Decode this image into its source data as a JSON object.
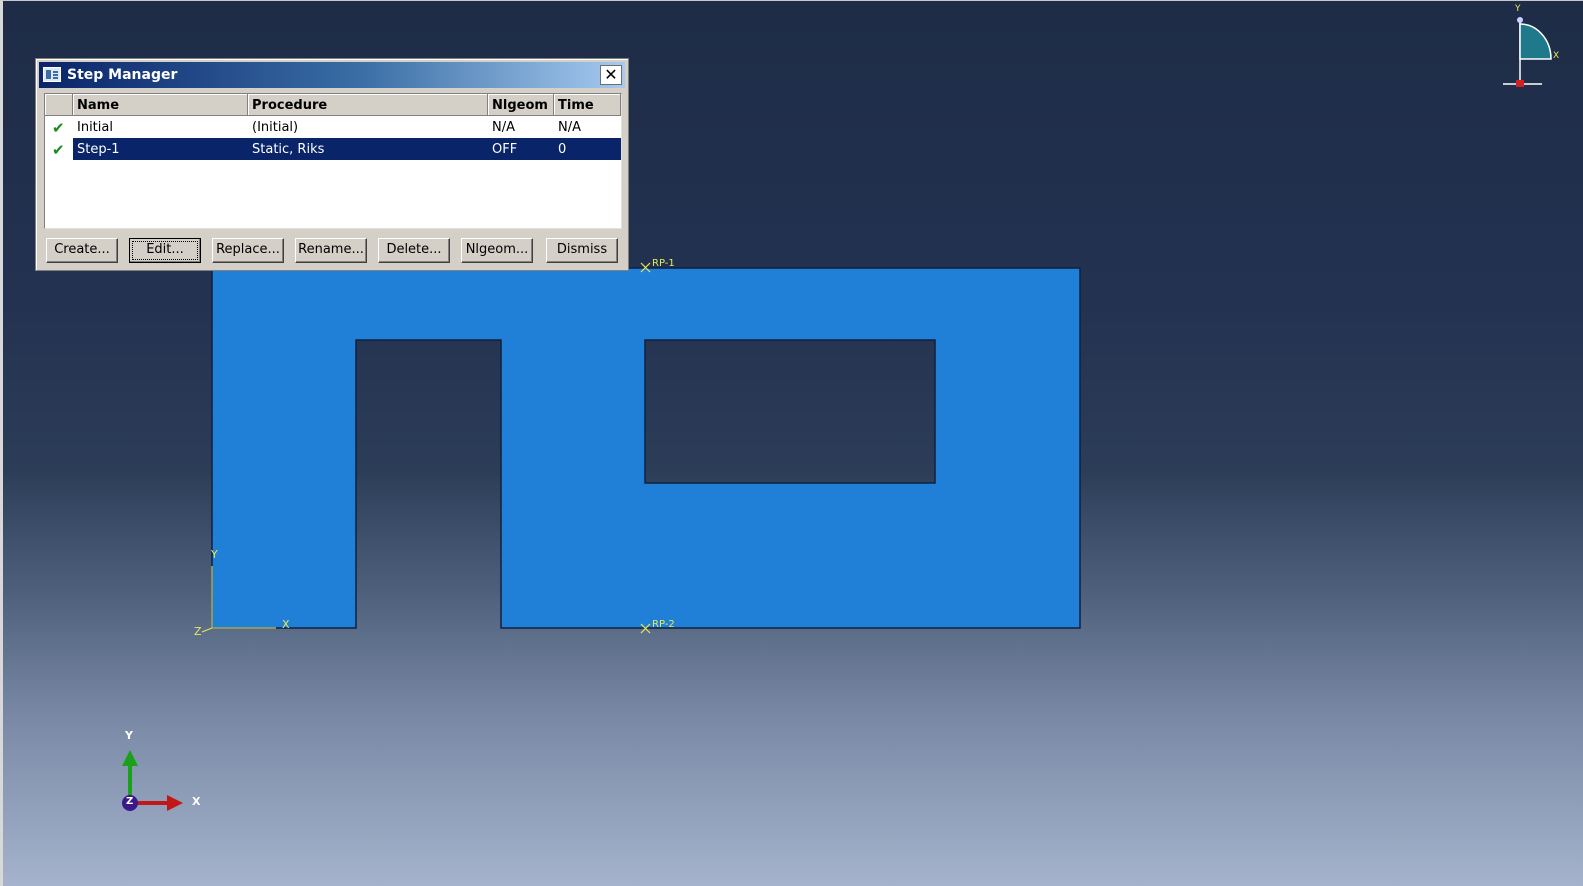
{
  "dialog": {
    "title": "Step Manager",
    "close_label": "✕",
    "columns": [
      "Name",
      "Procedure",
      "Nlgeom",
      "Time"
    ],
    "rows": [
      {
        "status": "✔",
        "name": "Initial",
        "procedure": "(Initial)",
        "nlgeom": "N/A",
        "time": "N/A"
      },
      {
        "status": "✔",
        "name": "Step-1",
        "procedure": "Static, Riks",
        "nlgeom": "OFF",
        "time": "0"
      }
    ],
    "selected_row": 1,
    "buttons": {
      "create": "Create...",
      "edit": "Edit...",
      "replace": "Replace...",
      "rename": "Rename...",
      "delete": "Delete...",
      "nlgeom": "Nlgeom...",
      "dismiss": "Dismiss"
    }
  },
  "viewport": {
    "part_color": "#2080d8",
    "reference_points": {
      "rp1": "RP-1",
      "rp2": "RP-2"
    },
    "local_axes": {
      "x": "X",
      "y": "Y",
      "z": "Z"
    },
    "triad": {
      "x": "X",
      "y": "Y",
      "z": "Z"
    },
    "view_cube": {
      "x": "X",
      "y": "Y"
    }
  }
}
